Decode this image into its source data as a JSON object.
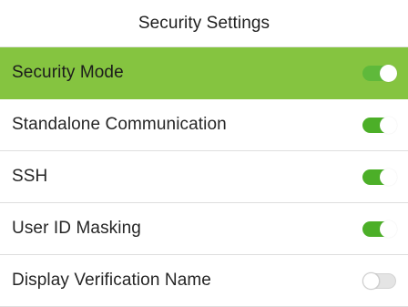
{
  "header": {
    "title": "Security Settings"
  },
  "settings": [
    {
      "label": "Security Mode",
      "enabled": true,
      "selected": true
    },
    {
      "label": "Standalone Communication",
      "enabled": true,
      "selected": false
    },
    {
      "label": "SSH",
      "enabled": true,
      "selected": false
    },
    {
      "label": "User ID Masking",
      "enabled": true,
      "selected": false
    },
    {
      "label": "Display Verification Name",
      "enabled": false,
      "selected": false
    }
  ],
  "colors": {
    "selected_row": "#85c440",
    "toggle_on": "#4caf28",
    "toggle_off": "#e4e4e4"
  }
}
